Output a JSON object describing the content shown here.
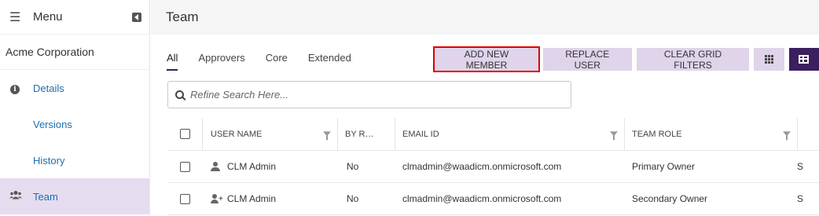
{
  "sidebar": {
    "menu_label": "Menu",
    "org_name": "Acme Corporation",
    "items": [
      {
        "label": "Details",
        "icon": "info-icon"
      },
      {
        "label": "Versions",
        "icon": ""
      },
      {
        "label": "History",
        "icon": ""
      },
      {
        "label": "Team",
        "icon": "users-icon"
      }
    ]
  },
  "header": {
    "title": "Team"
  },
  "tabs": [
    {
      "label": "All"
    },
    {
      "label": "Approvers"
    },
    {
      "label": "Core"
    },
    {
      "label": "Extended"
    }
  ],
  "toolbar": {
    "add_new_member": "ADD NEW MEMBER",
    "replace_user": "REPLACE USER",
    "clear_grid_filters": "CLEAR GRID FILTERS"
  },
  "search": {
    "placeholder": "Refine Search Here..."
  },
  "grid": {
    "columns": [
      "USER NAME",
      "BY R…",
      "EMAIL ID",
      "TEAM ROLE"
    ],
    "rows": [
      {
        "user_name": "CLM Admin",
        "by_r": "No",
        "email": "clmadmin@waadicm.onmicrosoft.com",
        "team_role": "Primary Owner",
        "more": "S"
      },
      {
        "user_name": "CLM Admin",
        "by_r": "No",
        "email": "clmadmin@waadicm.onmicrosoft.com",
        "team_role": "Secondary Owner",
        "more": "S"
      }
    ]
  },
  "colors": {
    "accent": "#3b1f5e",
    "button_bg": "#dfd4ea",
    "active_nav_bg": "#e6dcef",
    "link": "#1a6fb3",
    "highlight": "#e00000"
  }
}
